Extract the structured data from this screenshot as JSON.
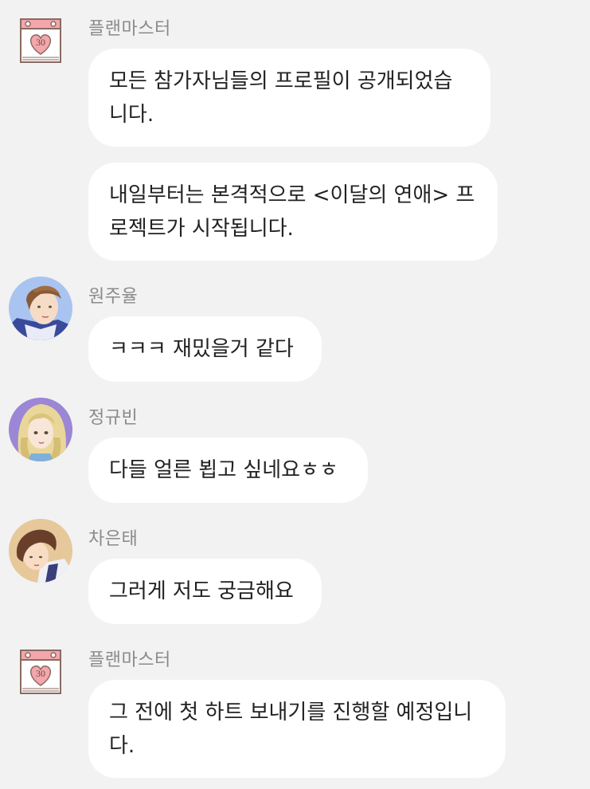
{
  "messages": [
    {
      "sender": "플랜마스터",
      "bubbles": [
        {
          "lines": [
            "모든 참가자님들의 프로필이 공개되었습",
            "니다."
          ]
        },
        {
          "lines": [
            "내일부터는 본격적으로 <이달의 연애> 프",
            "로젝트가 시작됩니다."
          ]
        }
      ]
    },
    {
      "sender": "원주율",
      "bubbles": [
        {
          "lines": [
            "ㅋㅋㅋ 재밌을거 같다"
          ]
        }
      ]
    },
    {
      "sender": "정규빈",
      "bubbles": [
        {
          "lines": [
            "다들 얼른 뵙고 싶네요ㅎㅎ"
          ]
        }
      ]
    },
    {
      "sender": "차은태",
      "bubbles": [
        {
          "lines": [
            "그러게 저도 궁금해요"
          ]
        }
      ]
    },
    {
      "sender": "플랜마스터",
      "bubbles": [
        {
          "lines": [
            "그 전에 첫 하트 보내기를 진행할 예정입니",
            "다."
          ]
        }
      ]
    }
  ],
  "calendar_icon": {
    "number": "30",
    "icon": "heart-calendar-icon"
  },
  "colors": {
    "background": "#f2f2f2",
    "bubble": "#ffffff",
    "sender_text": "#8a8a8a",
    "message_text": "#222222",
    "calendar_accent": "#f4a6ad"
  }
}
